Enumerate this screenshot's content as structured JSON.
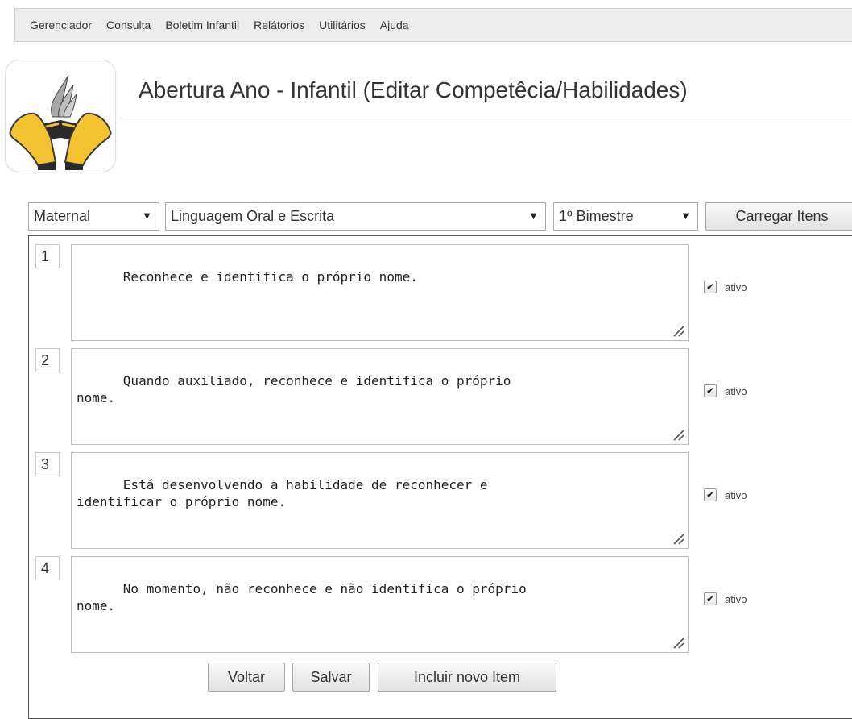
{
  "menu": [
    "Gerenciador",
    "Consulta",
    "Boletim Infantil",
    "Relátorios",
    "Utilitários",
    "Ajuda"
  ],
  "title": "Abertura Ano - Infantil (Editar Competêcia/Habilidades)",
  "filters": {
    "level": "Maternal",
    "subject": "Linguagem Oral e Escrita",
    "period": "1º Bimestre",
    "load_button": "Carregar Itens"
  },
  "items": [
    {
      "number": "1",
      "text": "Reconhece e identifica o próprio nome.",
      "active_label": "ativo",
      "active": true
    },
    {
      "number": "2",
      "text": "Quando auxiliado, reconhece e identifica o próprio\nnome.",
      "active_label": "ativo",
      "active": true
    },
    {
      "number": "3",
      "text": "Está desenvolvendo a habilidade de reconhecer e\nidentificar o próprio nome.",
      "active_label": "ativo",
      "active": true
    },
    {
      "number": "4",
      "text": "No momento, não reconhece e não identifica o próprio\nnome.",
      "active_label": "ativo",
      "active": true
    }
  ],
  "actions": {
    "back": "Voltar",
    "save": "Salvar",
    "add": "Incluir novo Item"
  },
  "colors": {
    "menu_bg": "#ededed",
    "logo_yellow": "#f2c230",
    "logo_dark": "#2b2b2b"
  }
}
